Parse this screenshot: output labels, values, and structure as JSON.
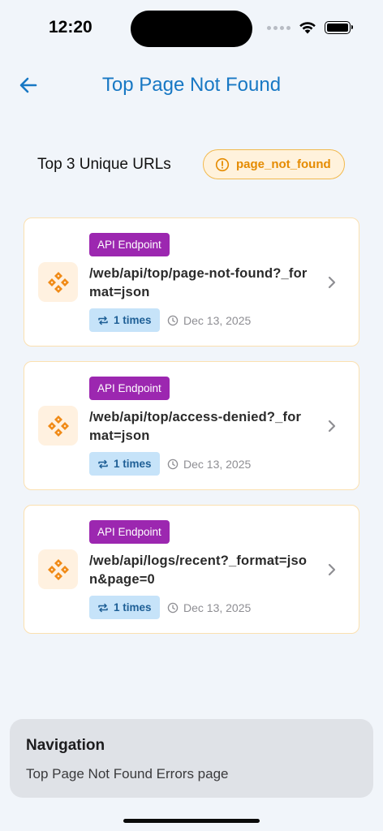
{
  "status_bar": {
    "time": "12:20"
  },
  "header": {
    "title": "Top Page Not Found"
  },
  "summary": {
    "text": "Top 3 Unique URLs",
    "error_type": "page_not_found"
  },
  "cards": [
    {
      "type_label": "API Endpoint",
      "url": "/web/api/top/page-not-found?_format=json",
      "count": "1 times",
      "date": "Dec 13, 2025"
    },
    {
      "type_label": "API Endpoint",
      "url": "/web/api/top/access-denied?_format=json",
      "count": "1 times",
      "date": "Dec 13, 2025"
    },
    {
      "type_label": "API Endpoint",
      "url": "/web/api/logs/recent?_format=json&page=0",
      "count": "1 times",
      "date": "Dec 13, 2025"
    }
  ],
  "navigation_info": {
    "title": "Navigation",
    "description": "Top Page Not Found Errors page"
  },
  "colors": {
    "accent": "#1878c4",
    "warning": "#e58b00",
    "badge": "#9c27b0",
    "chip": "#c6e3f9"
  },
  "icons": [
    "back-arrow-icon",
    "alert-circle-icon",
    "api-diamond-icon",
    "repeat-icon",
    "clock-icon",
    "chevron-right-icon",
    "wifi-icon",
    "battery-icon"
  ]
}
